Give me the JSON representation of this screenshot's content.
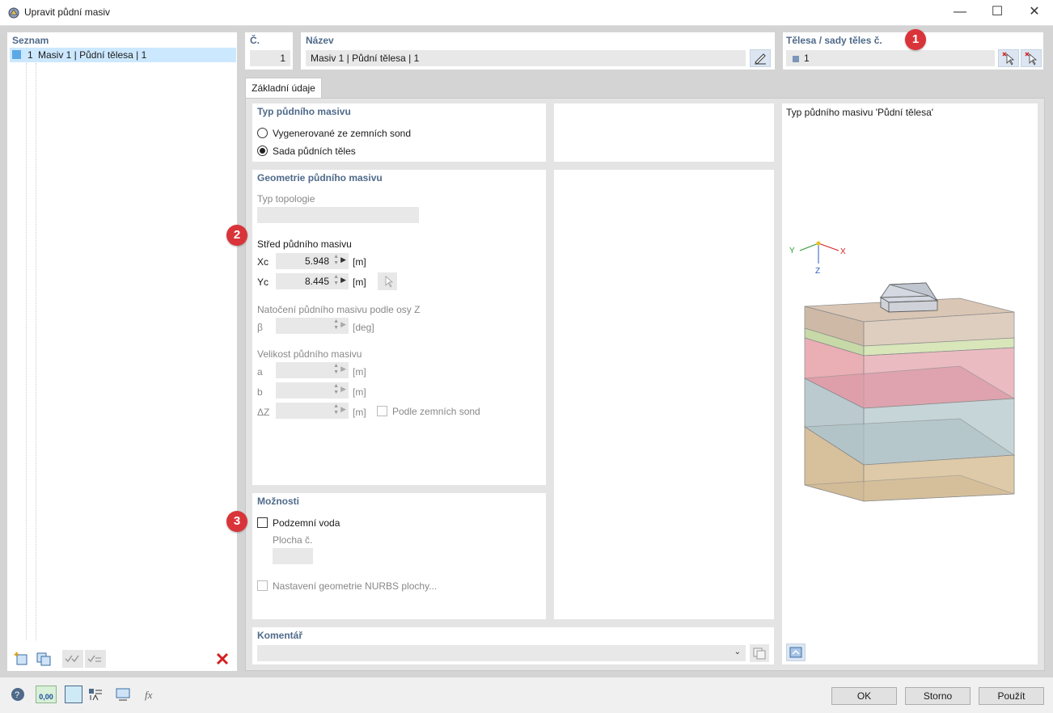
{
  "window": {
    "title": "Upravit půdní masiv",
    "minimize_glyph": "—",
    "maximize_glyph": "☐",
    "close_glyph": "✕"
  },
  "list_panel": {
    "header": "Seznam",
    "items": [
      {
        "number": "1",
        "label": "Masiv 1 | Půdní tělesa | 1",
        "color": "#5aa9e6"
      }
    ]
  },
  "number_field": {
    "label": "Č.",
    "value": "1"
  },
  "name_field": {
    "label": "Název",
    "value": "Masiv 1 | Půdní tělesa | 1"
  },
  "solids_field": {
    "label": "Tělesa / sady těles č.",
    "value": "1"
  },
  "tabs": [
    {
      "label": "Základní údaje"
    }
  ],
  "soil_type": {
    "header": "Typ půdního masivu",
    "options": [
      {
        "label": "Vygenerované ze zemních sond",
        "selected": false
      },
      {
        "label": "Sada půdních těles",
        "selected": true
      }
    ]
  },
  "geometry": {
    "header": "Geometrie půdního masivu",
    "topology_label": "Typ topologie",
    "center_label": "Střed půdního masivu",
    "xc": {
      "label": "Xc",
      "value": "5.948",
      "unit": "[m]"
    },
    "yc": {
      "label": "Yc",
      "value": "8.445",
      "unit": "[m]"
    },
    "rotation_label": "Natočení půdního masivu podle osy Z",
    "beta": {
      "label": "β",
      "unit": "[deg]"
    },
    "size_label": "Velikost půdního masivu",
    "a": {
      "label": "a",
      "unit": "[m]"
    },
    "b": {
      "label": "b",
      "unit": "[m]"
    },
    "dz": {
      "label": "ΔZ",
      "unit": "[m]"
    },
    "by_boreholes_label": "Podle zemních sond"
  },
  "options": {
    "header": "Možnosti",
    "groundwater_label": "Podzemní voda",
    "surface_label": "Plocha č.",
    "nurbs_label": "Nastavení geometrie NURBS plochy..."
  },
  "preview": {
    "title": "Typ půdního masivu 'Půdní tělesa'",
    "axes": {
      "x": "X",
      "y": "Y",
      "z": "Z"
    }
  },
  "comment": {
    "header": "Komentář"
  },
  "badges": [
    "1",
    "2",
    "3"
  ],
  "footer": {
    "ok": "OK",
    "cancel": "Storno",
    "apply": "Použít",
    "units_icon_text": "0,00"
  },
  "colors": {
    "accent_header": "#4f6a8a",
    "selection": "#cce8ff",
    "badge": "#d9343a",
    "delete": "#d42020"
  }
}
